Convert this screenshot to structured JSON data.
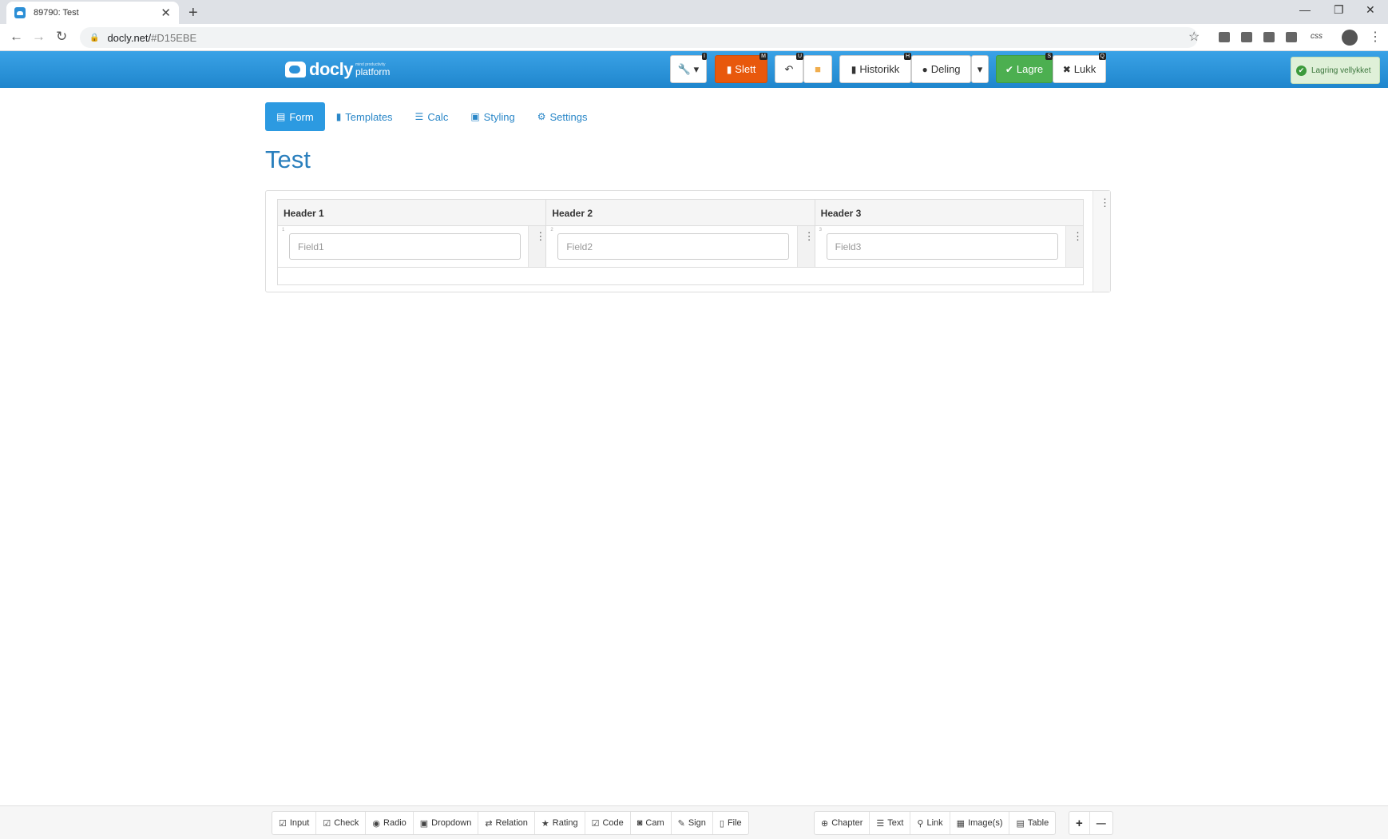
{
  "browser": {
    "tab_title": "89790: Test",
    "tab_close": "✕",
    "new_tab": "+",
    "url_host": "docly.net/",
    "url_hash": "#D15EBE",
    "win_min": "—",
    "win_restore": "❐",
    "win_close": "✕",
    "back": "←",
    "forward": "→",
    "reload": "↻",
    "lock": "🔒",
    "star": "☆",
    "menu": "⋮",
    "ext_css": "css"
  },
  "app": {
    "logo_word": "docly",
    "logo_tagline": "mind productivity",
    "logo_platform": "platform",
    "toolbar": {
      "tools_icon": "🔧 ▾",
      "tools_key": "I",
      "delete_label": "Slett",
      "delete_key": "M",
      "undo_icon": "↶",
      "undo_key": "U",
      "comment_icon": "■",
      "history_label": "Historikk",
      "history_key": "H",
      "share_label": "Deling",
      "share_dropdown": "▾",
      "save_label": "Lagre",
      "save_key": "S",
      "close_label": "Lukk",
      "close_key": "Q"
    },
    "toast": "Lagring vellykket",
    "colors": {
      "primary": "#2c9ae1",
      "danger": "#e8580c",
      "success": "#4caf50"
    }
  },
  "nav": {
    "tabs": [
      {
        "label": "Form",
        "icon": "▤"
      },
      {
        "label": "Templates",
        "icon": "▮"
      },
      {
        "label": "Calc",
        "icon": "☰"
      },
      {
        "label": "Styling",
        "icon": "▣"
      },
      {
        "label": "Settings",
        "icon": "⚙"
      }
    ]
  },
  "page": {
    "title": "Test"
  },
  "form_table": {
    "headers": [
      "Header 1",
      "Header 2",
      "Header 3"
    ],
    "cells": [
      {
        "index": "1",
        "placeholder": "Field1"
      },
      {
        "index": "2",
        "placeholder": "Field2"
      },
      {
        "index": "3",
        "placeholder": "Field3"
      }
    ],
    "menu_icon": "⋮"
  },
  "bottom_toolbar": {
    "group1": [
      {
        "label": "Input",
        "icon": "☑"
      },
      {
        "label": "Check",
        "icon": "☑"
      },
      {
        "label": "Radio",
        "icon": "◉"
      },
      {
        "label": "Dropdown",
        "icon": "▣"
      },
      {
        "label": "Relation",
        "icon": "⇄"
      },
      {
        "label": "Rating",
        "icon": "★"
      },
      {
        "label": "Code",
        "icon": "☑"
      },
      {
        "label": "Cam",
        "icon": "◙"
      },
      {
        "label": "Sign",
        "icon": "✎"
      },
      {
        "label": "File",
        "icon": "▯"
      }
    ],
    "group2": [
      {
        "label": "Chapter",
        "icon": "⊕"
      },
      {
        "label": "Text",
        "icon": "☰"
      },
      {
        "label": "Link",
        "icon": "⚲"
      },
      {
        "label": "Image(s)",
        "icon": "▦"
      },
      {
        "label": "Table",
        "icon": "▤"
      }
    ],
    "plus": "+",
    "minus": "—"
  }
}
